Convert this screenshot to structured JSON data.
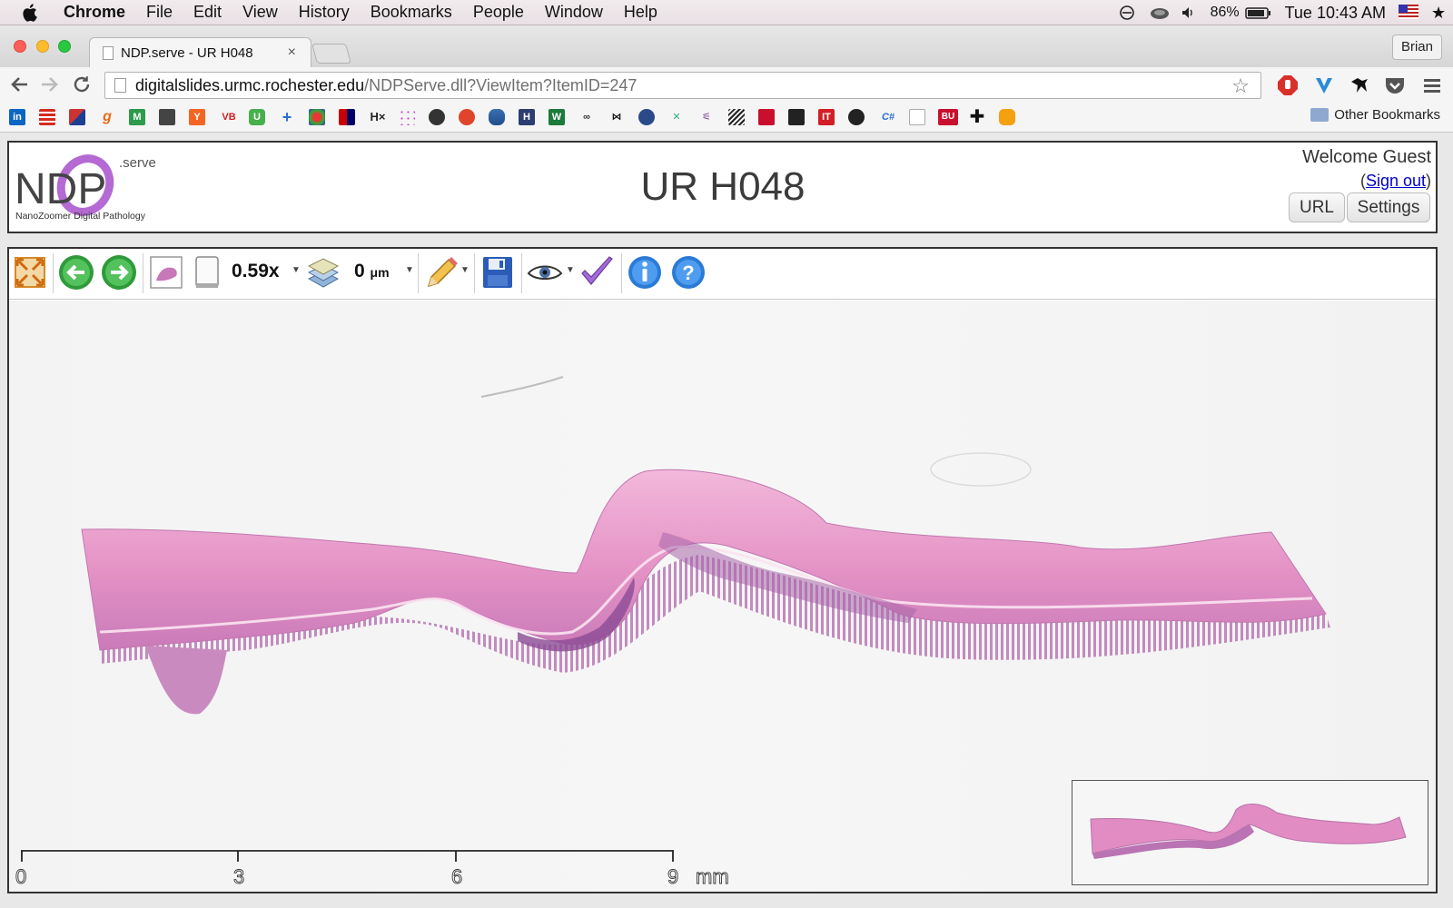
{
  "menubar": {
    "app": "Chrome",
    "items": [
      "File",
      "Edit",
      "View",
      "History",
      "Bookmarks",
      "People",
      "Window",
      "Help"
    ],
    "battery": "86%",
    "clock": "Tue 10:43 AM"
  },
  "browser": {
    "tab_title": "NDP.serve - UR H048",
    "tab_close": "×",
    "profile": "Brian",
    "url_host": "digitalslides.urmc.rochester.edu",
    "url_path": "/NDPServe.dll?ViewItem?ItemID=247",
    "bookmark_labels": [
      "in",
      "VB",
      "U",
      "H×",
      "C#",
      "BU"
    ],
    "other_bookmarks": "Other Bookmarks"
  },
  "header": {
    "logo_text": "NDP",
    "logo_sub": ".serve",
    "logo_tagline": "NanoZoomer Digital Pathology",
    "title": "UR H048",
    "welcome": "Welcome Guest",
    "signout": "Sign out",
    "url_button": "URL",
    "settings_button": "Settings"
  },
  "toolbar": {
    "zoom": "0.59x",
    "focus_value": "0",
    "focus_unit": "μm"
  },
  "scalebar": {
    "ticks": [
      "0",
      "3",
      "6",
      "9"
    ],
    "unit": "mm"
  },
  "colors": {
    "tissue_pink": "#e89ac8",
    "tissue_purple": "#9a4f9e",
    "link": "#0000cc"
  }
}
